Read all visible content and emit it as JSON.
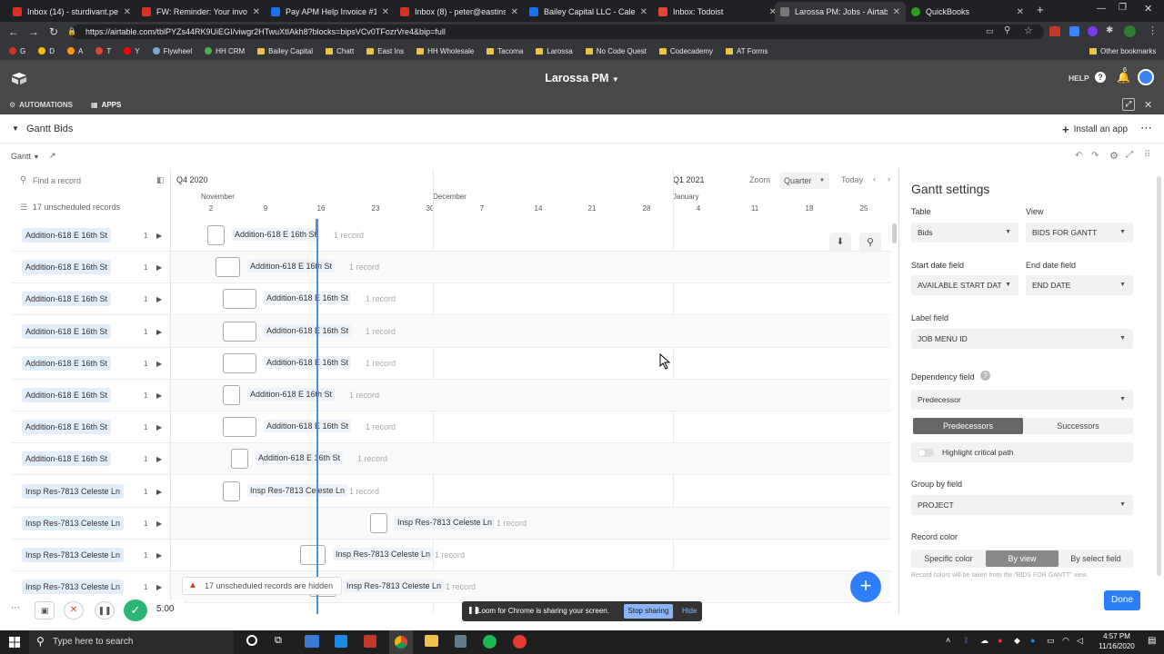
{
  "browser": {
    "tabs": [
      {
        "title": "Inbox (14) - sturdivant.pete",
        "color": "#d93025"
      },
      {
        "title": "FW: Reminder: Your invoice",
        "color": "#d93025"
      },
      {
        "title": "Pay APM Help Invoice #142",
        "color": "#1a73e8"
      },
      {
        "title": "Inbox (8) - peter@eastinsur",
        "color": "#d93025"
      },
      {
        "title": "Bailey Capital LLC - Calend",
        "color": "#1a73e8"
      },
      {
        "title": "Inbox: Todoist",
        "color": "#e44332"
      },
      {
        "title": "Larossa PM: Jobs - Airtable",
        "color": "#777777"
      },
      {
        "title": "QuickBooks",
        "color": "#2ca01c"
      }
    ],
    "url": "https://airtable.com/tblPYZs44RK9UiEGI/viwgr2HTwuXtIAkh8?blocks=bipsVCv0TFozrVre4&bip=full",
    "bookmarks": [
      "G",
      "D",
      "A",
      "T",
      "Y",
      "Flywheel",
      "HH CRM",
      "Bailey Capital",
      "Chatt",
      "East Ins",
      "HH Wholesale",
      "Tacoma",
      "Larossa",
      "No Code Quest",
      "Codecademy",
      "AT Forms"
    ],
    "other_bookmarks": "Other bookmarks"
  },
  "header": {
    "base_title": "Larossa PM",
    "help": "HELP",
    "notif_count": "6",
    "automations": "AUTOMATIONS",
    "apps": "APPS"
  },
  "appbar": {
    "title": "Gantt Bids",
    "install": "Install an app"
  },
  "toolbar": {
    "view_label": "Gantt",
    "search_placeholder": "Find a record",
    "unscheduled": "17 unscheduled records",
    "quarter_left": "Q4 2020",
    "quarter_right": "Q1 2021",
    "zoom": "Zoom",
    "zoom_value": "Quarter",
    "today": "Today"
  },
  "timeline": {
    "months": [
      {
        "label": "November"
      },
      {
        "label": "December"
      },
      {
        "label": "January"
      }
    ],
    "days": [
      "2",
      "9",
      "16",
      "23",
      "30",
      "7",
      "14",
      "21",
      "28",
      "4",
      "11",
      "18",
      "25"
    ]
  },
  "rows": [
    {
      "name": "Addition-618 E 16th St",
      "count": "1",
      "records": "1 record"
    },
    {
      "name": "Addition-618 E 16th St",
      "count": "1",
      "records": "1 record"
    },
    {
      "name": "Addition-618 E 16th St",
      "count": "1",
      "records": "1 record"
    },
    {
      "name": "Addition-618 E 16th St",
      "count": "1",
      "records": "1 record"
    },
    {
      "name": "Addition-618 E 16th St",
      "count": "1",
      "records": "1 record"
    },
    {
      "name": "Addition-618 E 16th St",
      "count": "1",
      "records": "1 record"
    },
    {
      "name": "Addition-618 E 16th St",
      "count": "1",
      "records": "1 record"
    },
    {
      "name": "Addition-618 E 16th St",
      "count": "1",
      "records": "1 record"
    },
    {
      "name": "Insp Res-7813 Celeste Ln",
      "count": "1",
      "records": "1 record"
    },
    {
      "name": "Insp Res-7813 Celeste Ln",
      "count": "1",
      "records": "1 record"
    },
    {
      "name": "Insp Res-7813 Celeste Ln",
      "count": "1",
      "records": "1 record"
    },
    {
      "name": "Insp Res-7813 Celeste Ln",
      "count": "1",
      "records": "1 record"
    }
  ],
  "hidden_notice": "17 unscheduled records are hidden",
  "settings": {
    "title": "Gantt settings",
    "table_label": "Table",
    "table_value": "Bids",
    "view_label": "View",
    "view_value": "BIDS FOR GANTT",
    "start_label": "Start date field",
    "start_value": "AVAILABLE START DAT",
    "end_label": "End date field",
    "end_value": "END DATE",
    "label_field_label": "Label field",
    "label_field_value": "JOB MENU ID",
    "dep_label": "Dependency field",
    "dep_value": "Predecessor",
    "pred": "Predecessors",
    "succ": "Successors",
    "critical": "Highlight critical path",
    "group_label": "Group by field",
    "group_value": "PROJECT",
    "color_label": "Record color",
    "color_specific": "Specific color",
    "color_view": "By view",
    "color_select": "By select field",
    "color_note": "Record colors will be taken from the \"BIDS FOR GANTT\" view.",
    "done": "Done"
  },
  "loom": {
    "timer": "5:00",
    "share_msg": "Loom for Chrome is sharing your screen.",
    "stop": "Stop sharing",
    "hide": "Hide"
  },
  "taskbar": {
    "search": "Type here to search",
    "time": "4:57 PM",
    "date": "11/16/2020"
  }
}
